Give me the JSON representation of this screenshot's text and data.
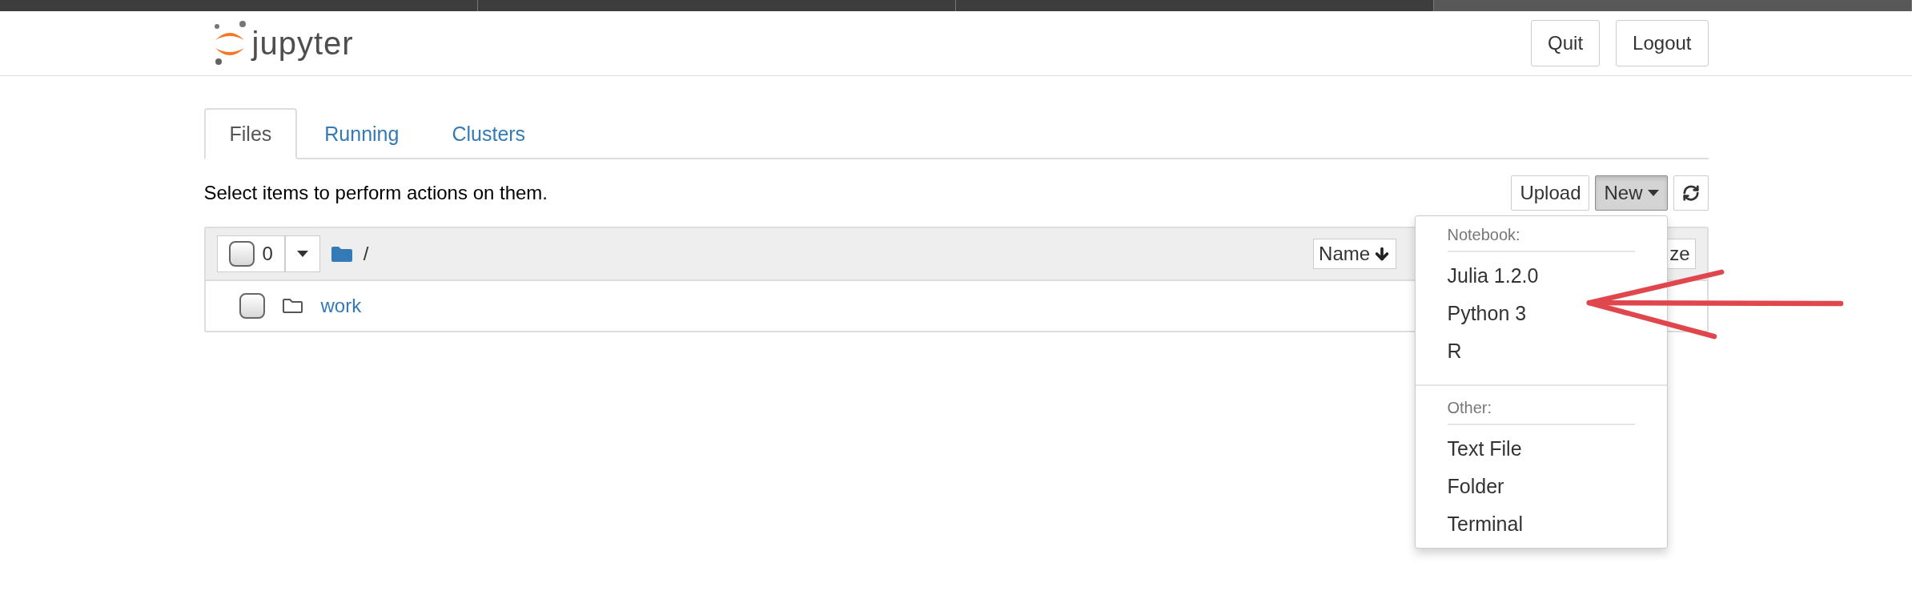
{
  "header": {
    "brand": "jupyter",
    "buttons": [
      "Quit",
      "Logout"
    ]
  },
  "tabs": [
    {
      "label": "Files",
      "selected": true
    },
    {
      "label": "Running",
      "selected": false
    },
    {
      "label": "Clusters",
      "selected": false
    }
  ],
  "toolbar": {
    "hint": "Select items to perform actions on them.",
    "upload": "Upload",
    "new": {
      "label": "New",
      "expanded": true
    }
  },
  "list": {
    "select_all_checked": false,
    "selected_count": "0",
    "path": "/",
    "sort_columns": [
      {
        "label": "Name",
        "sorted": true
      },
      {
        "label": "ze",
        "sorted": false
      }
    ],
    "items": [
      {
        "kind": "folder",
        "name": "work",
        "checked": false
      }
    ]
  },
  "new_menu": {
    "sections": [
      {
        "header": "Notebook:",
        "items": [
          "Julia 1.2.0",
          "Python 3",
          "R"
        ]
      },
      {
        "header": "Other:",
        "items": [
          "Text File",
          "Folder",
          "Terminal"
        ]
      }
    ]
  }
}
